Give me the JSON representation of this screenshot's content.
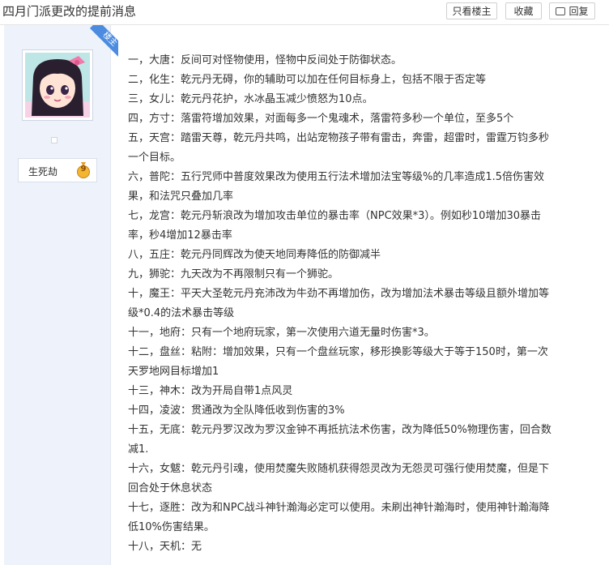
{
  "header": {
    "title": "四月门派更改的提前消息",
    "btn_only_lz": "只看楼主",
    "btn_favorite": "收藏",
    "btn_reply": "回复"
  },
  "author": {
    "badge": "楼主",
    "username": "生死劫",
    "level": "9"
  },
  "post": {
    "lines": [
      "一，大唐：反间可对怪物使用，怪物中反间处于防御状态。",
      "二，化生：乾元丹无碍，你的辅助可以加在任何目标身上，包括不限于否定等",
      "三，女儿：乾元丹花护，水冰晶玉减少愤怒为10点。",
      "四，方寸：落雷符增加效果，对面每多一个鬼魂术，落雷符多秒一个单位，至多5个",
      "五，天宫：踏雷天尊，乾元丹共鸣，出站宠物孩子带有雷击，奔雷，超雷时，雷霆万钧多秒",
      "一个目标。",
      "六，普陀：五行咒师中普度效果改为使用五行法术增加法宝等级%的几率造成1.5倍伤害效",
      "果，和法咒只叠加几率",
      "七，龙宫：乾元丹斩浪改为增加攻击单位的暴击率（NPC效果*3）。例如秒10增加30暴击",
      "率，秒4增加12暴击率",
      "八，五庄：乾元丹同辉改为使天地同寿降低的防御减半",
      "九，狮驼：九天改为不再限制只有一个狮驼。",
      "十，魔王：平天大圣乾元丹充沛改为牛劲不再增加伤，改为增加法术暴击等级且额外增加等",
      "级*0.4的法术暴击等级",
      "十一，地府：只有一个地府玩家，第一次使用六道无量时伤害*3。",
      "十二，盘丝：粘附：增加效果，只有一个盘丝玩家，移形换影等级大于等于150时，第一次",
      "天罗地网目标增加1",
      "十三，神木：改为开局自带1点风灵",
      "十四，凌波：贯通改为全队降低收到伤害的3%",
      "十五，无底：乾元丹罗汉改为罗汉金钟不再抵抗法术伤害，改为降低50%物理伤害，回合数",
      "减1.",
      "十六，女魃：乾元丹引魂，使用焚魔失败随机获得怨灵改为无怨灵可强行使用焚魔，但是下",
      "回合处于休息状态",
      "十七，逐胜：改为和NPC战斗神针瀚海必定可以使用。未刷出神针瀚海时，使用神针瀚海降",
      "低10%伤害结果。",
      "十八，天机：无"
    ]
  },
  "colors": {
    "sidebar_bg": "#eef3fb",
    "badge_blue": "#4b8ce0",
    "level_gold": "#f2b632"
  }
}
